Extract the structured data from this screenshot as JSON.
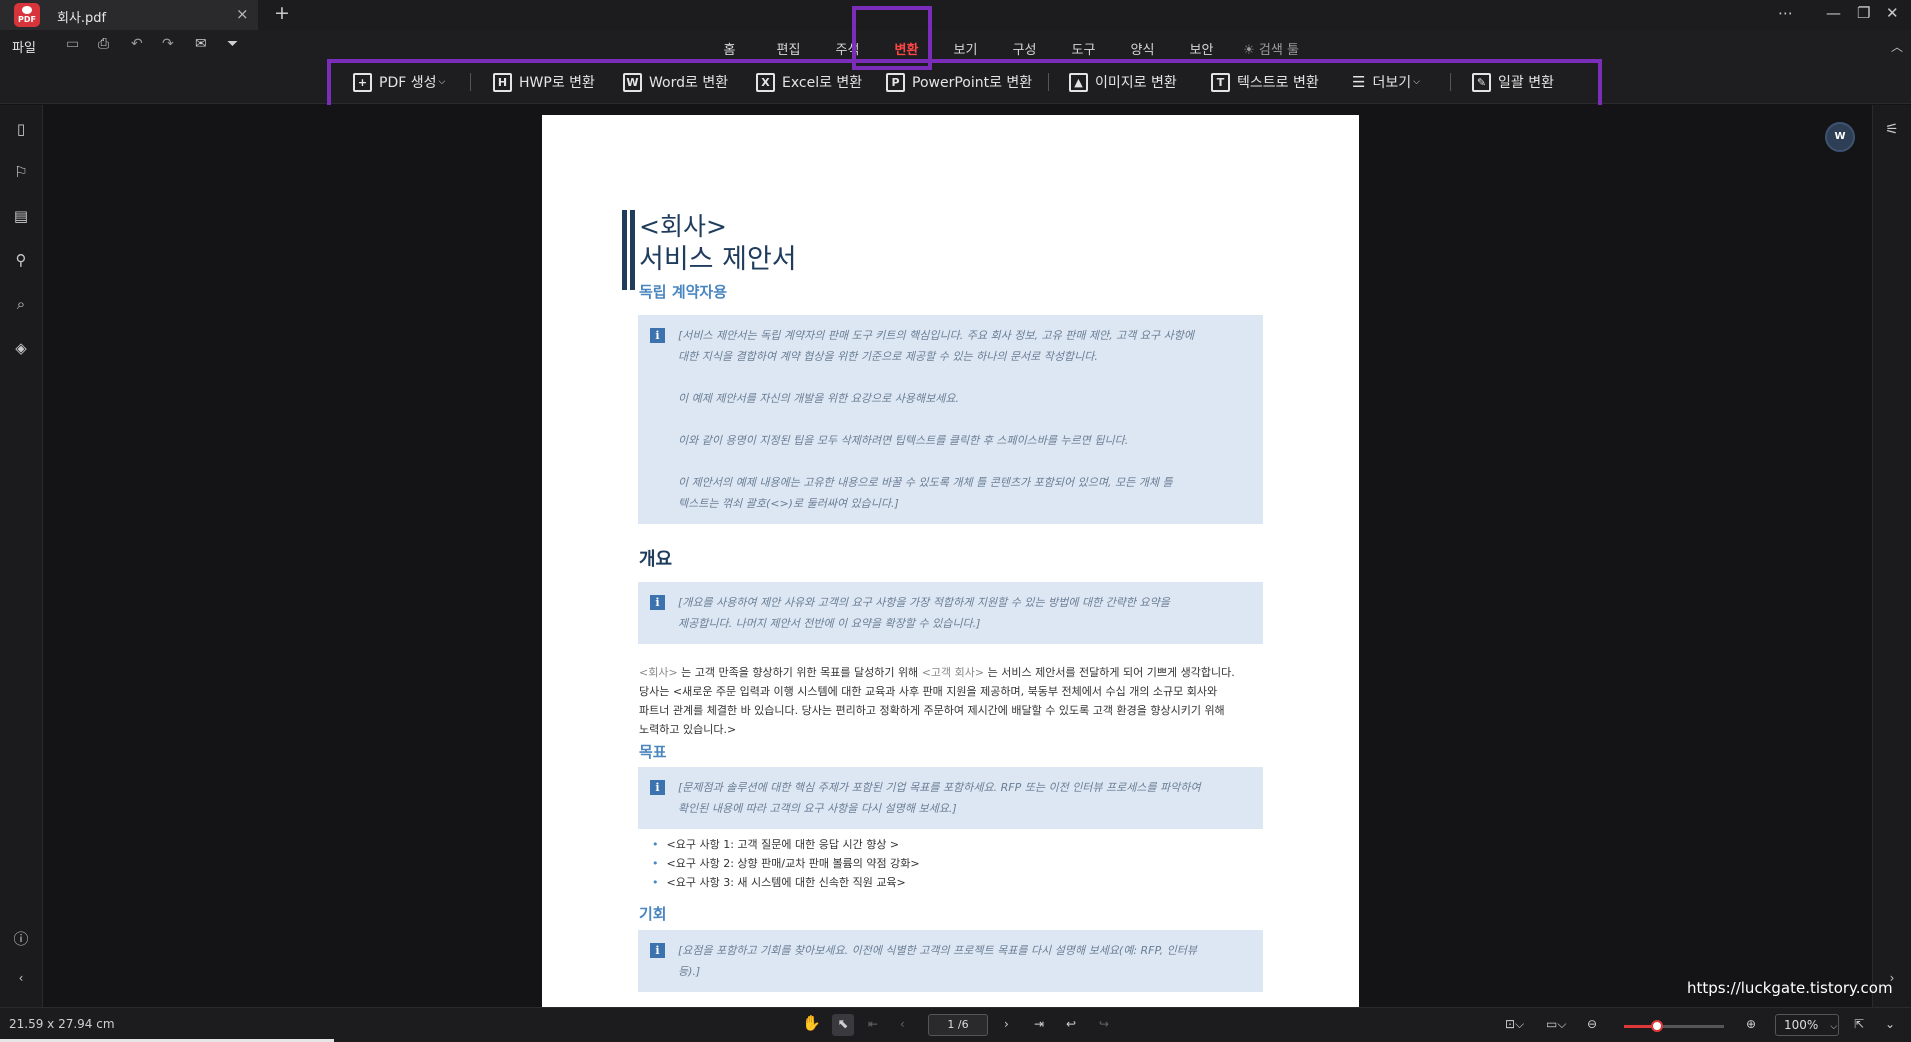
{
  "tab": {
    "title": "회사.pdf",
    "close": "×",
    "add": "+",
    "logo_text": "PDF"
  },
  "window": {
    "more": "⋯",
    "minimize": "—",
    "restore": "❐",
    "close": "✕"
  },
  "file_menu": "파일",
  "menu_tabs": [
    "홈",
    "편집",
    "주석",
    "변환",
    "보기",
    "구성",
    "도구",
    "양식",
    "보안",
    "검색 툴"
  ],
  "active_tab": "변환",
  "tools": {
    "pdf_create": "PDF 생성",
    "hwp": "HWP로 변환",
    "word": "Word로 변환",
    "excel": "Excel로 변환",
    "ppt": "PowerPoint로 변환",
    "image": "이미지로 변환",
    "text": "텍스트로 변환",
    "more": "더보기",
    "batch": "일괄 변환"
  },
  "tool_icons": {
    "hwp": "H",
    "word": "W",
    "excel": "X",
    "ppt": "P",
    "text": "T"
  },
  "document": {
    "title_line1": "<회사>",
    "title_line2": "서비스 제안서",
    "subtitle": "독립 계약자용",
    "info1": [
      "[서비스 제안서는 독립 계약자의 판매 도구 키트의 핵심입니다. 주요 회사 정보, 고유 판매 제안, 고객 요구 사항에",
      "대한 지식을 결합하여 계약 협상을 위한 기준으로 제공할 수 있는 하나의 문서로 작성합니다.",
      "이 예제 제안서를 자신의 개발을 위한 요강으로 사용해보세요.",
      "이와 같이 용명이 지정된 팁을 모두 삭제하려면 팁텍스트를 클릭한 후 스페이스바를 누르면 됩니다.",
      "이 제안서의 예제 내용에는 고유한 내용으로 바꿀 수 있도록 개체 틀 콘텐츠가 포함되어 있으며, 모든 개체 틀",
      "텍스트는 꺾쇠 괄호(<>)로 둘러싸여 있습니다.]"
    ],
    "h_overview": "개요",
    "info2": [
      "[개요를 사용하여 제안 사유와 고객의 요구 사항을 가장 적합하게 지원할 수 있는 방법에 대한 간략한 요약을",
      "제공합니다. 나머지 제안서 전반에 이 요약을 확장할 수 있습니다.]"
    ],
    "body_p1_a": "<회사>",
    "body_p1_b": " 는 고객 만족을 향상하기 위한 목표를 달성하기 위해 ",
    "body_p1_c": "<고객 회사>",
    "body_p1_d": " 는 서비스 제안서를 전달하게 되어 기쁘게 생각합니다.",
    "body_p2": "당사는 <새로운 주문 입력과 이행 시스템에 대한 교육과 사후 판매 지원을 제공하며, 북동부 전체에서 수십 개의 소규모 회사와",
    "body_p3": "파트너 관계를 체결한 바 있습니다. 당사는 편리하고 정확하게 주문하여 제시간에 배달할 수 있도록 고객 환경을 향상시키기 위해",
    "body_p4": "노력하고 있습니다.>",
    "h_goals": "목표",
    "info3": [
      "[문제점과 솔루션에 대한 핵심 주제가 포함된 기업 목표를 포함하세요. RFP 또는 이전 인터뷰 프로세스를 파악하여",
      "확인된 내용에 따라 고객의 요구 사항을 다시 설명해 보세요.]"
    ],
    "bullets": [
      "<요구 사항 1: 고객 질문에 대한 응답 시간 향상 >",
      "<요구 사항 2: 상향 판매/교차 판매 볼륨의 약점 강화>",
      "<요구 사항 3: 새 시스템에 대한 신속한 직원 교육>"
    ],
    "h_opportunity": "기회",
    "info4": [
      "[요점을 포함하고 기회를 찾아보세요. 이전에 식별한 고객의 프로젝트 목표를 다시 설명해 보세요(예: RFP, 인터뷰",
      "등).]"
    ]
  },
  "watermark": "https://luckgate.tistory.com",
  "floating_badge": "W",
  "status": {
    "page_size": "21.59 x 27.94 cm",
    "page_indicator": "1 /6",
    "zoom": "100%",
    "zoom_level": 0.33
  }
}
